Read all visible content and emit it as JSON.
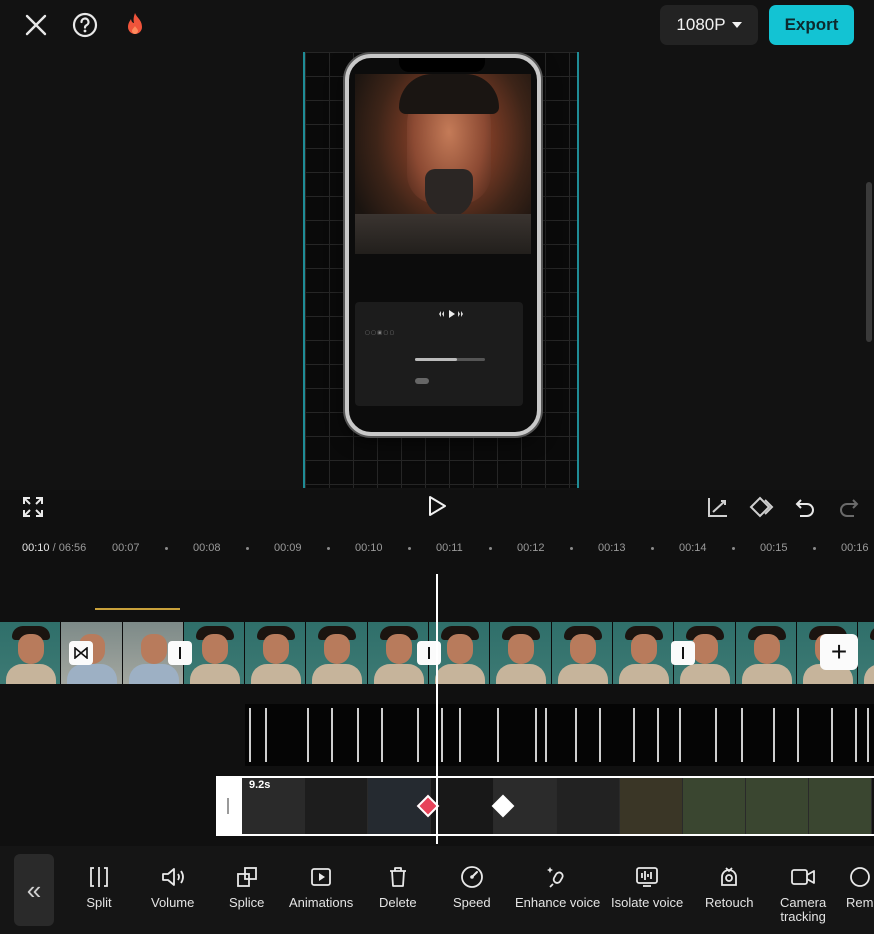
{
  "topbar": {
    "resolution_label": "1080P",
    "export_label": "Export"
  },
  "ruler": {
    "current_time": "00:10",
    "separator": "/",
    "total_time": "06:56",
    "ticks": [
      "00:07",
      "00:08",
      "00:09",
      "00:10",
      "00:11",
      "00:12",
      "00:13",
      "00:14",
      "00:15",
      "00:16"
    ]
  },
  "timeline": {
    "selected_clip_duration": "9.2s"
  },
  "toolbar": {
    "collapse_label": "«",
    "tools": [
      {
        "id": "split",
        "label": "Split"
      },
      {
        "id": "volume",
        "label": "Volume"
      },
      {
        "id": "splice",
        "label": "Splice"
      },
      {
        "id": "animations",
        "label": "Animations"
      },
      {
        "id": "delete",
        "label": "Delete"
      },
      {
        "id": "speed",
        "label": "Speed"
      },
      {
        "id": "enhance-voice",
        "label": "Enhance voice"
      },
      {
        "id": "isolate-voice",
        "label": "Isolate voice"
      },
      {
        "id": "retouch",
        "label": "Retouch"
      },
      {
        "id": "camera-tracking",
        "label": "Camera\ntracking"
      },
      {
        "id": "remove",
        "label": "Rem"
      }
    ]
  },
  "colors": {
    "accent": "#13c3d3",
    "keyframe_active": "#e8435a",
    "timeline_accent": "#c9a13b"
  }
}
